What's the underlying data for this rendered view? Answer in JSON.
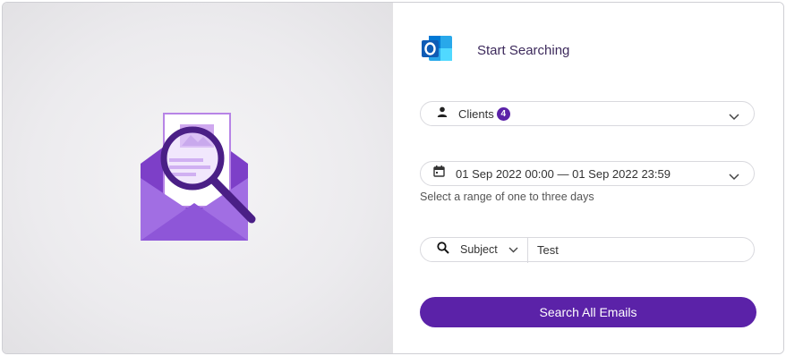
{
  "header": {
    "title": "Start Searching",
    "logo_icon": "outlook-icon"
  },
  "clients_filter": {
    "label": "Clients",
    "count": "4",
    "icon": "person-icon"
  },
  "date_filter": {
    "range": "01 Sep 2022 00:00 — 01 Sep 2022 23:59",
    "hint": "Select a range of one to three days",
    "icon": "calendar-icon"
  },
  "search": {
    "field": "Subject",
    "value": "Test",
    "icon": "search-icon"
  },
  "actions": {
    "search_label": "Search All Emails"
  },
  "colors": {
    "accent": "#5b22a8",
    "envelope": "#8e56d8",
    "magnifier": "#4a1f86"
  }
}
